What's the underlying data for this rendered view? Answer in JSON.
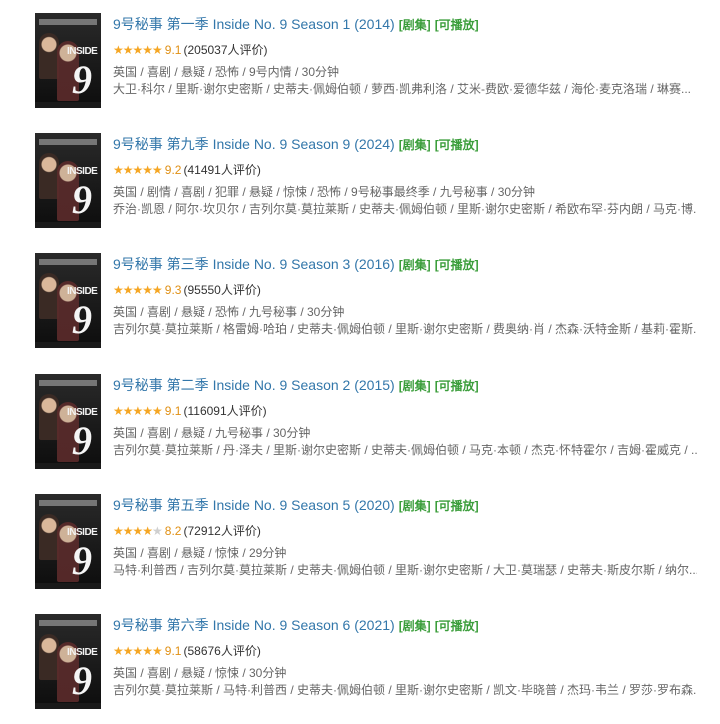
{
  "items": [
    {
      "title": "9号秘事 第一季 Inside No. 9 Season 1 (2014)",
      "tag_type": "[剧集]",
      "tag_play": "[可播放]",
      "stars": "★★★★★",
      "stars_off": "",
      "score": "9.1",
      "votes": "(205037人评价)",
      "meta": "英国 / 喜剧 / 悬疑 / 恐怖 / 9号内情 / 30分钟",
      "cast": "大卫·科尔 / 里斯·谢尔史密斯 / 史蒂夫·佩姆伯顿 / 萝西·凯弗利洛 / 艾米-费欧·爱德华兹 / 海伦·麦克洛瑞 / 琳赛..."
    },
    {
      "title": "9号秘事 第九季 Inside No. 9 Season 9 (2024)",
      "tag_type": "[剧集]",
      "tag_play": "[可播放]",
      "stars": "★★★★★",
      "stars_off": "",
      "score": "9.2",
      "votes": "(41491人评价)",
      "meta": "英国 / 剧情 / 喜剧 / 犯罪 / 悬疑 / 惊悚 / 恐怖 / 9号秘事最终季 / 九号秘事 / 30分钟",
      "cast": "乔治·凯恩 / 阿尔·坎贝尔 / 吉列尔莫·莫拉莱斯 / 史蒂夫·佩姆伯顿 / 里斯·谢尔史密斯 / 希欧布罕·芬内朗 / 马克·博..."
    },
    {
      "title": "9号秘事 第三季 Inside No. 9 Season 3 (2016)",
      "tag_type": "[剧集]",
      "tag_play": "[可播放]",
      "stars": "★★★★★",
      "stars_off": "",
      "score": "9.3",
      "votes": "(95550人评价)",
      "meta": "英国 / 喜剧 / 悬疑 / 恐怖 / 九号秘事 / 30分钟",
      "cast": "吉列尔莫·莫拉莱斯 / 格雷姆·哈珀 / 史蒂夫·佩姆伯顿 / 里斯·谢尔史密斯 / 费奥纳·肖 / 杰森·沃特金斯 / 基莉·霍斯..."
    },
    {
      "title": "9号秘事 第二季 Inside No. 9 Season 2 (2015)",
      "tag_type": "[剧集]",
      "tag_play": "[可播放]",
      "stars": "★★★★★",
      "stars_off": "",
      "score": "9.1",
      "votes": "(116091人评价)",
      "meta": "英国 / 喜剧 / 悬疑 / 九号秘事 / 30分钟",
      "cast": "吉列尔莫·莫拉莱斯 / 丹·泽夫 / 里斯·谢尔史密斯 / 史蒂夫·佩姆伯顿 / 马克·本顿 / 杰克·怀特霍尔 / 吉姆·霍威克 / ..."
    },
    {
      "title": "9号秘事 第五季 Inside No. 9 Season 5 (2020)",
      "tag_type": "[剧集]",
      "tag_play": "[可播放]",
      "stars": "★★★★",
      "stars_off": "★",
      "score": "8.2",
      "votes": "(72912人评价)",
      "meta": "英国 / 喜剧 / 悬疑 / 惊悚 / 29分钟",
      "cast": "马特·利普西 / 吉列尔莫·莫拉莱斯 / 史蒂夫·佩姆伯顿 / 里斯·谢尔史密斯 / 大卫·莫瑞瑟 / 史蒂夫·斯皮尔斯 / 纳尔..."
    },
    {
      "title": "9号秘事 第六季 Inside No. 9 Season 6 (2021)",
      "tag_type": "[剧集]",
      "tag_play": "[可播放]",
      "stars": "★★★★★",
      "stars_off": "",
      "score": "9.1",
      "votes": "(58676人评价)",
      "meta": "英国 / 喜剧 / 悬疑 / 惊悚 / 30分钟",
      "cast": "吉列尔莫·莫拉莱斯 / 马特·利普西 / 史蒂夫·佩姆伯顿 / 里斯·谢尔史密斯 / 凯文·毕晓普 / 杰玛·韦兰 / 罗莎·罗布森..."
    }
  ],
  "poster": {
    "inside_text": "INSIDE",
    "nine_text": "9"
  },
  "colors": {
    "title_link": "#3377aa",
    "tag_green": "#3a9d3a",
    "star_gold": "#f5a623",
    "meta_gray": "#666666"
  }
}
